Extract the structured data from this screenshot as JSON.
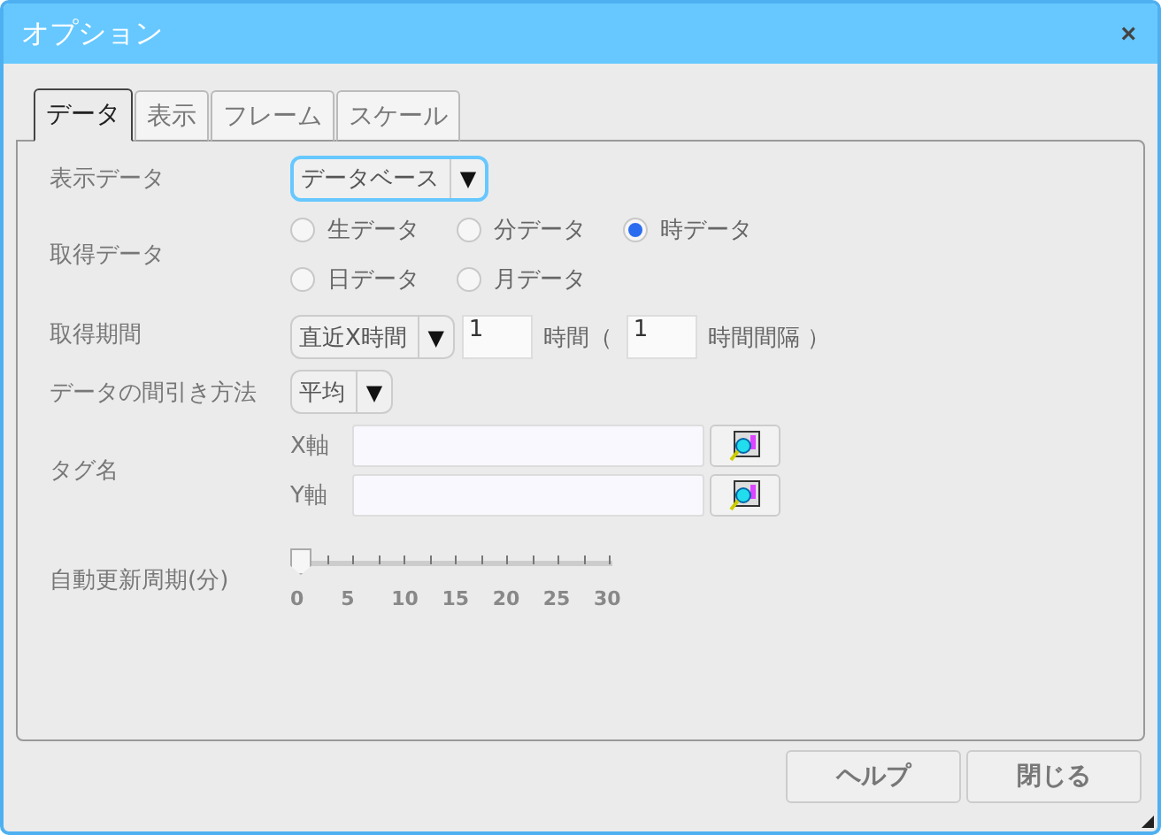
{
  "window": {
    "title": "オプション",
    "close": "×"
  },
  "tabs": [
    {
      "label": "データ",
      "selected": true
    },
    {
      "label": "表示",
      "selected": false
    },
    {
      "label": "フレーム",
      "selected": false
    },
    {
      "label": "スケール",
      "selected": false
    }
  ],
  "display_data": {
    "label": "表示データ",
    "value": "データベース",
    "arrow": "▼"
  },
  "fetch_data": {
    "label": "取得データ",
    "options": [
      {
        "label": "生データ",
        "selected": false
      },
      {
        "label": "分データ",
        "selected": false
      },
      {
        "label": "時データ",
        "selected": true
      },
      {
        "label": "日データ",
        "selected": false
      },
      {
        "label": "月データ",
        "selected": false
      }
    ]
  },
  "period": {
    "label": "取得期間",
    "mode": "直近X時間",
    "arrow": "▼",
    "hours": "1",
    "hours_unit": "時間（",
    "interval": "1",
    "interval_unit": "時間間隔 ）"
  },
  "thinning": {
    "label": "データの間引き方法",
    "value": "平均",
    "arrow": "▼"
  },
  "tags": {
    "label": "タグ名",
    "axes": [
      {
        "label": "X軸"
      },
      {
        "label": "Y軸"
      }
    ]
  },
  "refresh": {
    "label": "自動更新周期(分)",
    "level": 0,
    "ticks": [
      "0",
      "5",
      "10",
      "15",
      "20",
      "25",
      "30"
    ]
  },
  "buttons": [
    "ヘルプ",
    "閉じる"
  ]
}
